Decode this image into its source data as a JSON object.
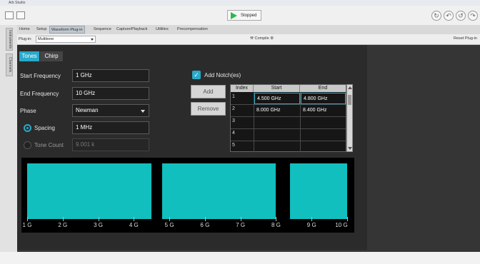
{
  "window": {
    "title": "Arb Studio"
  },
  "toolbar": {
    "run_status": "Stopped"
  },
  "side_tabs": [
    "Instruments",
    "Channels"
  ],
  "menu_tabs": [
    "Home",
    "Setup",
    "Waveform Plug-in",
    "Sequence",
    "Capture/Playback",
    "Utilities",
    "Precompensation"
  ],
  "plugin_bar": {
    "label": "Plug-in:",
    "selected": "Multitone",
    "compile_label": "Compile",
    "reset_label": "Reset Plug-in"
  },
  "tone_tabs": {
    "tones": "Tones",
    "chirp": "Chirp"
  },
  "form": {
    "start_frequency": {
      "label": "Start Frequency",
      "value": "1 GHz"
    },
    "end_frequency": {
      "label": "End Frequency",
      "value": "10 GHz"
    },
    "phase": {
      "label": "Phase",
      "value": "Newman"
    },
    "spacing": {
      "label": "Spacing",
      "value": "1 MHz",
      "selected": true
    },
    "tone_count": {
      "label": "Tone Count",
      "value": "9.001 k",
      "selected": false
    }
  },
  "notch": {
    "checkbox_label": "Add Notch(es)",
    "checked": true,
    "add_label": "Add",
    "remove_label": "Remove",
    "columns": [
      "Index",
      "Start",
      "End"
    ],
    "rows": [
      {
        "index": "1",
        "start": "4.500 GHz",
        "end": "4.800 GHz"
      },
      {
        "index": "2",
        "start": "8.000 GHz",
        "end": "8.400 GHz"
      },
      {
        "index": "3",
        "start": "",
        "end": ""
      },
      {
        "index": "4",
        "start": "",
        "end": ""
      },
      {
        "index": "5",
        "start": "",
        "end": ""
      }
    ]
  },
  "spectrum": {
    "bar_color": "#11bfbf",
    "x_min_ghz": 1,
    "x_max_ghz": 10,
    "tick_labels": [
      "1 G",
      "2 G",
      "3 G",
      "4 G",
      "5 G",
      "6 G",
      "7 G",
      "8 G",
      "9 G",
      "10 G"
    ],
    "tone_bands_ghz": [
      [
        1.0,
        4.5
      ],
      [
        4.8,
        8.0
      ],
      [
        8.4,
        10.0
      ]
    ]
  },
  "colors": {
    "accent": "#2aa9c9",
    "panel": "#2b2b2b",
    "run_icon": "#2db84b"
  }
}
